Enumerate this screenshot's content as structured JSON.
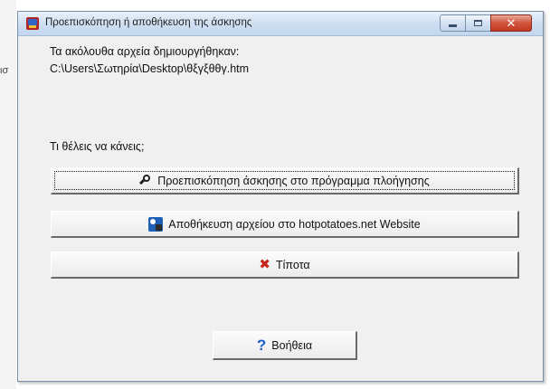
{
  "background": {
    "fragment_text": "ισ"
  },
  "dialog": {
    "title": "Προεπισκόπηση ή αποθήκευση της άσκησης",
    "close_glyph": "✕",
    "message_line1": "Τα ακόλουθα αρχεία δημιουργήθηκαν:",
    "message_line2": "C:\\Users\\Σωτηρία\\Desktop\\θξγξθθγ.htm",
    "question": "Τι θέλεις να κάνεις;",
    "buttons": {
      "preview": "Προεπισκόπηση άσκησης στο πρόγραμμα πλοήγησης",
      "save_web": "Αποθήκευση αρχείου στο hotpotatoes.net Website",
      "nothing": "Τίποτα",
      "help": "Βοήθεια"
    },
    "icons": {
      "preview": "magnifier-icon",
      "save_web": "web-upload-icon",
      "nothing": "red-x-icon",
      "help": "question-mark-icon"
    },
    "colors": {
      "close_button": "#c13a22",
      "x_icon": "#c8261b",
      "help_icon": "#1c5fc8"
    }
  }
}
